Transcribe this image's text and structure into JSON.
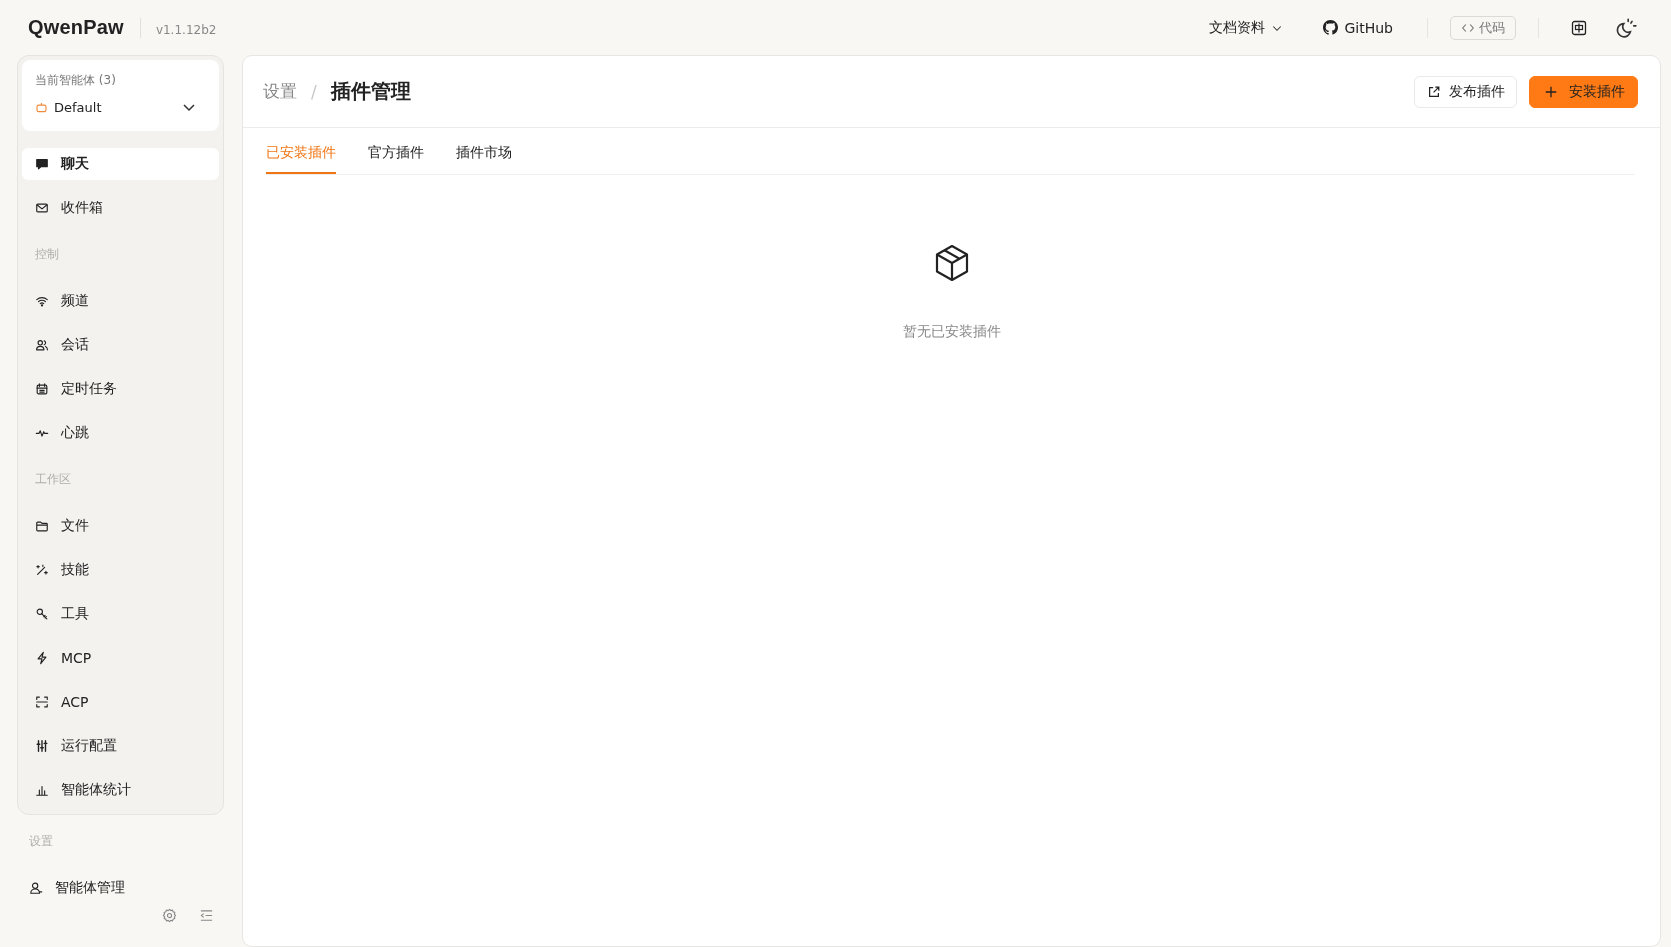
{
  "header": {
    "logo": "QwenPaw",
    "version": "v1.1.12b2",
    "nav": [
      {
        "kind": "dropdown",
        "label": "文档资料"
      },
      {
        "kind": "github",
        "label": "GitHub"
      },
      {
        "kind": "code",
        "label": "代码"
      }
    ]
  },
  "agent_selector": {
    "label": "当前智能体 (3)",
    "value": "Default"
  },
  "sidebar": {
    "sections": [
      {
        "items": [
          {
            "label": "聊天",
            "selected": true
          },
          {
            "label": "收件箱",
            "selected": false
          }
        ]
      },
      {
        "title": "控制",
        "items": [
          {
            "label": "频道",
            "selected": false
          },
          {
            "label": "会话",
            "selected": false
          },
          {
            "label": "定时任务",
            "selected": false
          },
          {
            "label": "心跳",
            "selected": false
          }
        ]
      },
      {
        "title": "工作区",
        "items": [
          {
            "label": "文件",
            "selected": false
          },
          {
            "label": "技能",
            "selected": false
          },
          {
            "label": "工具",
            "selected": false
          },
          {
            "label": "MCP",
            "selected": false
          },
          {
            "label": "ACP",
            "selected": false
          },
          {
            "label": "运行配置",
            "selected": false
          },
          {
            "label": "智能体统计",
            "selected": false
          }
        ]
      }
    ]
  },
  "settings_section": {
    "title": "设置",
    "items": [
      {
        "label": "智能体管理",
        "selected": false
      }
    ]
  },
  "breadcrumb": {
    "parent": "设置",
    "separator": "/",
    "current": "插件管理"
  },
  "actions": [
    {
      "kind": "default",
      "label": "发布插件"
    },
    {
      "kind": "primary",
      "label": "安装插件"
    }
  ],
  "tabs": [
    {
      "label": "已安装插件",
      "selected": true
    },
    {
      "label": "官方插件",
      "selected": false
    },
    {
      "label": "插件市场",
      "selected": false
    }
  ],
  "empty_state": {
    "text": "暂无已安装插件"
  }
}
